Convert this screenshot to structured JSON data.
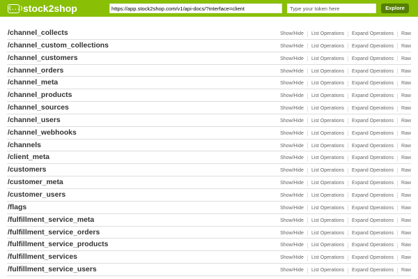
{
  "header": {
    "logo_icon": "{...}",
    "brand": "stock2shop",
    "url_value": "https://app.stock2shop.com/v1/api-docs/?interface=client",
    "token_placeholder": "Type your token here",
    "explore_label": "Explore",
    "colors": {
      "header_bg": "#89bf04",
      "explore_bg": "#547f00"
    }
  },
  "operation_labels": {
    "show_hide": "Show/Hide",
    "list_operations": "List Operations",
    "expand_operations": "Expand Operations",
    "raw": "Raw"
  },
  "resources": [
    "/channel_collects",
    "/channel_custom_collections",
    "/channel_customers",
    "/channel_orders",
    "/channel_meta",
    "/channel_products",
    "/channel_sources",
    "/channel_users",
    "/channel_webhooks",
    "/channels",
    "/client_meta",
    "/customers",
    "/customer_meta",
    "/customer_users",
    "/flags",
    "/fulfillment_service_meta",
    "/fulfillment_service_orders",
    "/fulfillment_service_products",
    "/fulfillment_services",
    "/fulfillment_service_users"
  ]
}
